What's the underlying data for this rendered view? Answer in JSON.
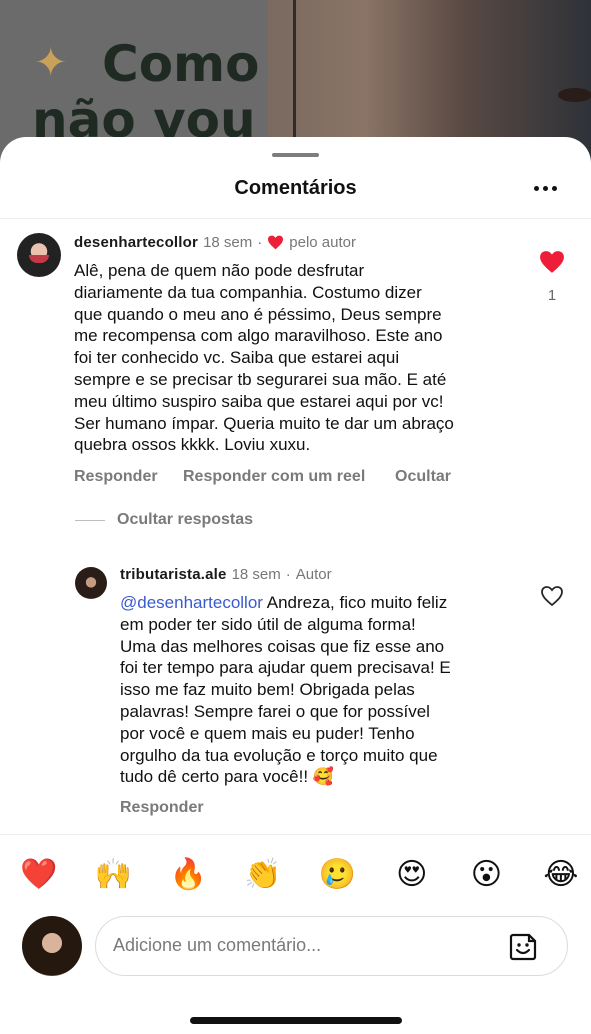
{
  "background": {
    "overlay_text": "Como\nnão vou",
    "spark_icon": "sparkles"
  },
  "sheet": {
    "title": "Comentários",
    "more_icon": "more-horizontal-icon"
  },
  "comment": {
    "username": "desenhartecollor",
    "time": "18 sem",
    "liked_by_author_label": "pelo autor",
    "text": "Alê, pena de quem não pode desfrutar diariamente da tua companhia. Costumo dizer que quando o meu ano é péssimo, Deus sempre me recompensa com algo maravilhoso. Este ano foi ter conhecido vc. Saiba que estarei aqui sempre e se precisar tb segurarei sua mão. E até meu último suspiro saiba que estarei aqui por vc! Ser humano ímpar. Queria muito te dar um abraço quebra ossos kkkk.  Loviu xuxu.",
    "text_lines": [
      "Alê, pena de quem não pode desfrutar",
      "diariamente da tua companhia. Costumo dizer",
      "que quando o meu ano é péssimo, Deus sempre",
      "me recompensa com algo maravilhoso. Este ano",
      "foi ter conhecido vc. Saiba que estarei aqui",
      "sempre e se precisar tb segurarei sua mão. E até",
      "meu último suspiro saiba que estarei aqui por vc!",
      "Ser humano ímpar. Queria muito te dar um abraço",
      "quebra ossos kkkk.  Loviu xuxu."
    ],
    "like_count": "1",
    "liked": true,
    "actions": [
      "Responder",
      "Responder com um reel",
      "Ocultar"
    ]
  },
  "hide_replies_label": "Ocultar respostas",
  "reply": {
    "username": "tributarista.ale",
    "time": "18 sem",
    "author_label": "Autor",
    "mention": "@desenhartecollor",
    "text_first": " Andreza, fico muito feliz",
    "text_lines": [
      "em poder ter sido útil de alguma forma!",
      "Uma das melhores coisas que fiz esse ano",
      "foi ter tempo para ajudar quem precisava! E",
      "isso me faz muito bem! Obrigada pelas",
      "palavras! Sempre farei o que for possível",
      "por você e quem mais eu puder! Tenho",
      "orgulho da tua evolução e torço muito que",
      "tudo dê certo para você!! 🥰"
    ],
    "liked": false,
    "action": "Responder"
  },
  "emoji_bar": [
    "❤️",
    "🙌",
    "🔥",
    "👏",
    "🥲",
    "😍",
    "😮",
    "😂"
  ],
  "composer": {
    "placeholder": "Adicione um comentário...",
    "sticker_icon": "sticker-icon"
  },
  "colors": {
    "like_red": "#ee1d38",
    "mention_blue": "#3a5bcf",
    "secondary_text": "#7a7a7a"
  }
}
